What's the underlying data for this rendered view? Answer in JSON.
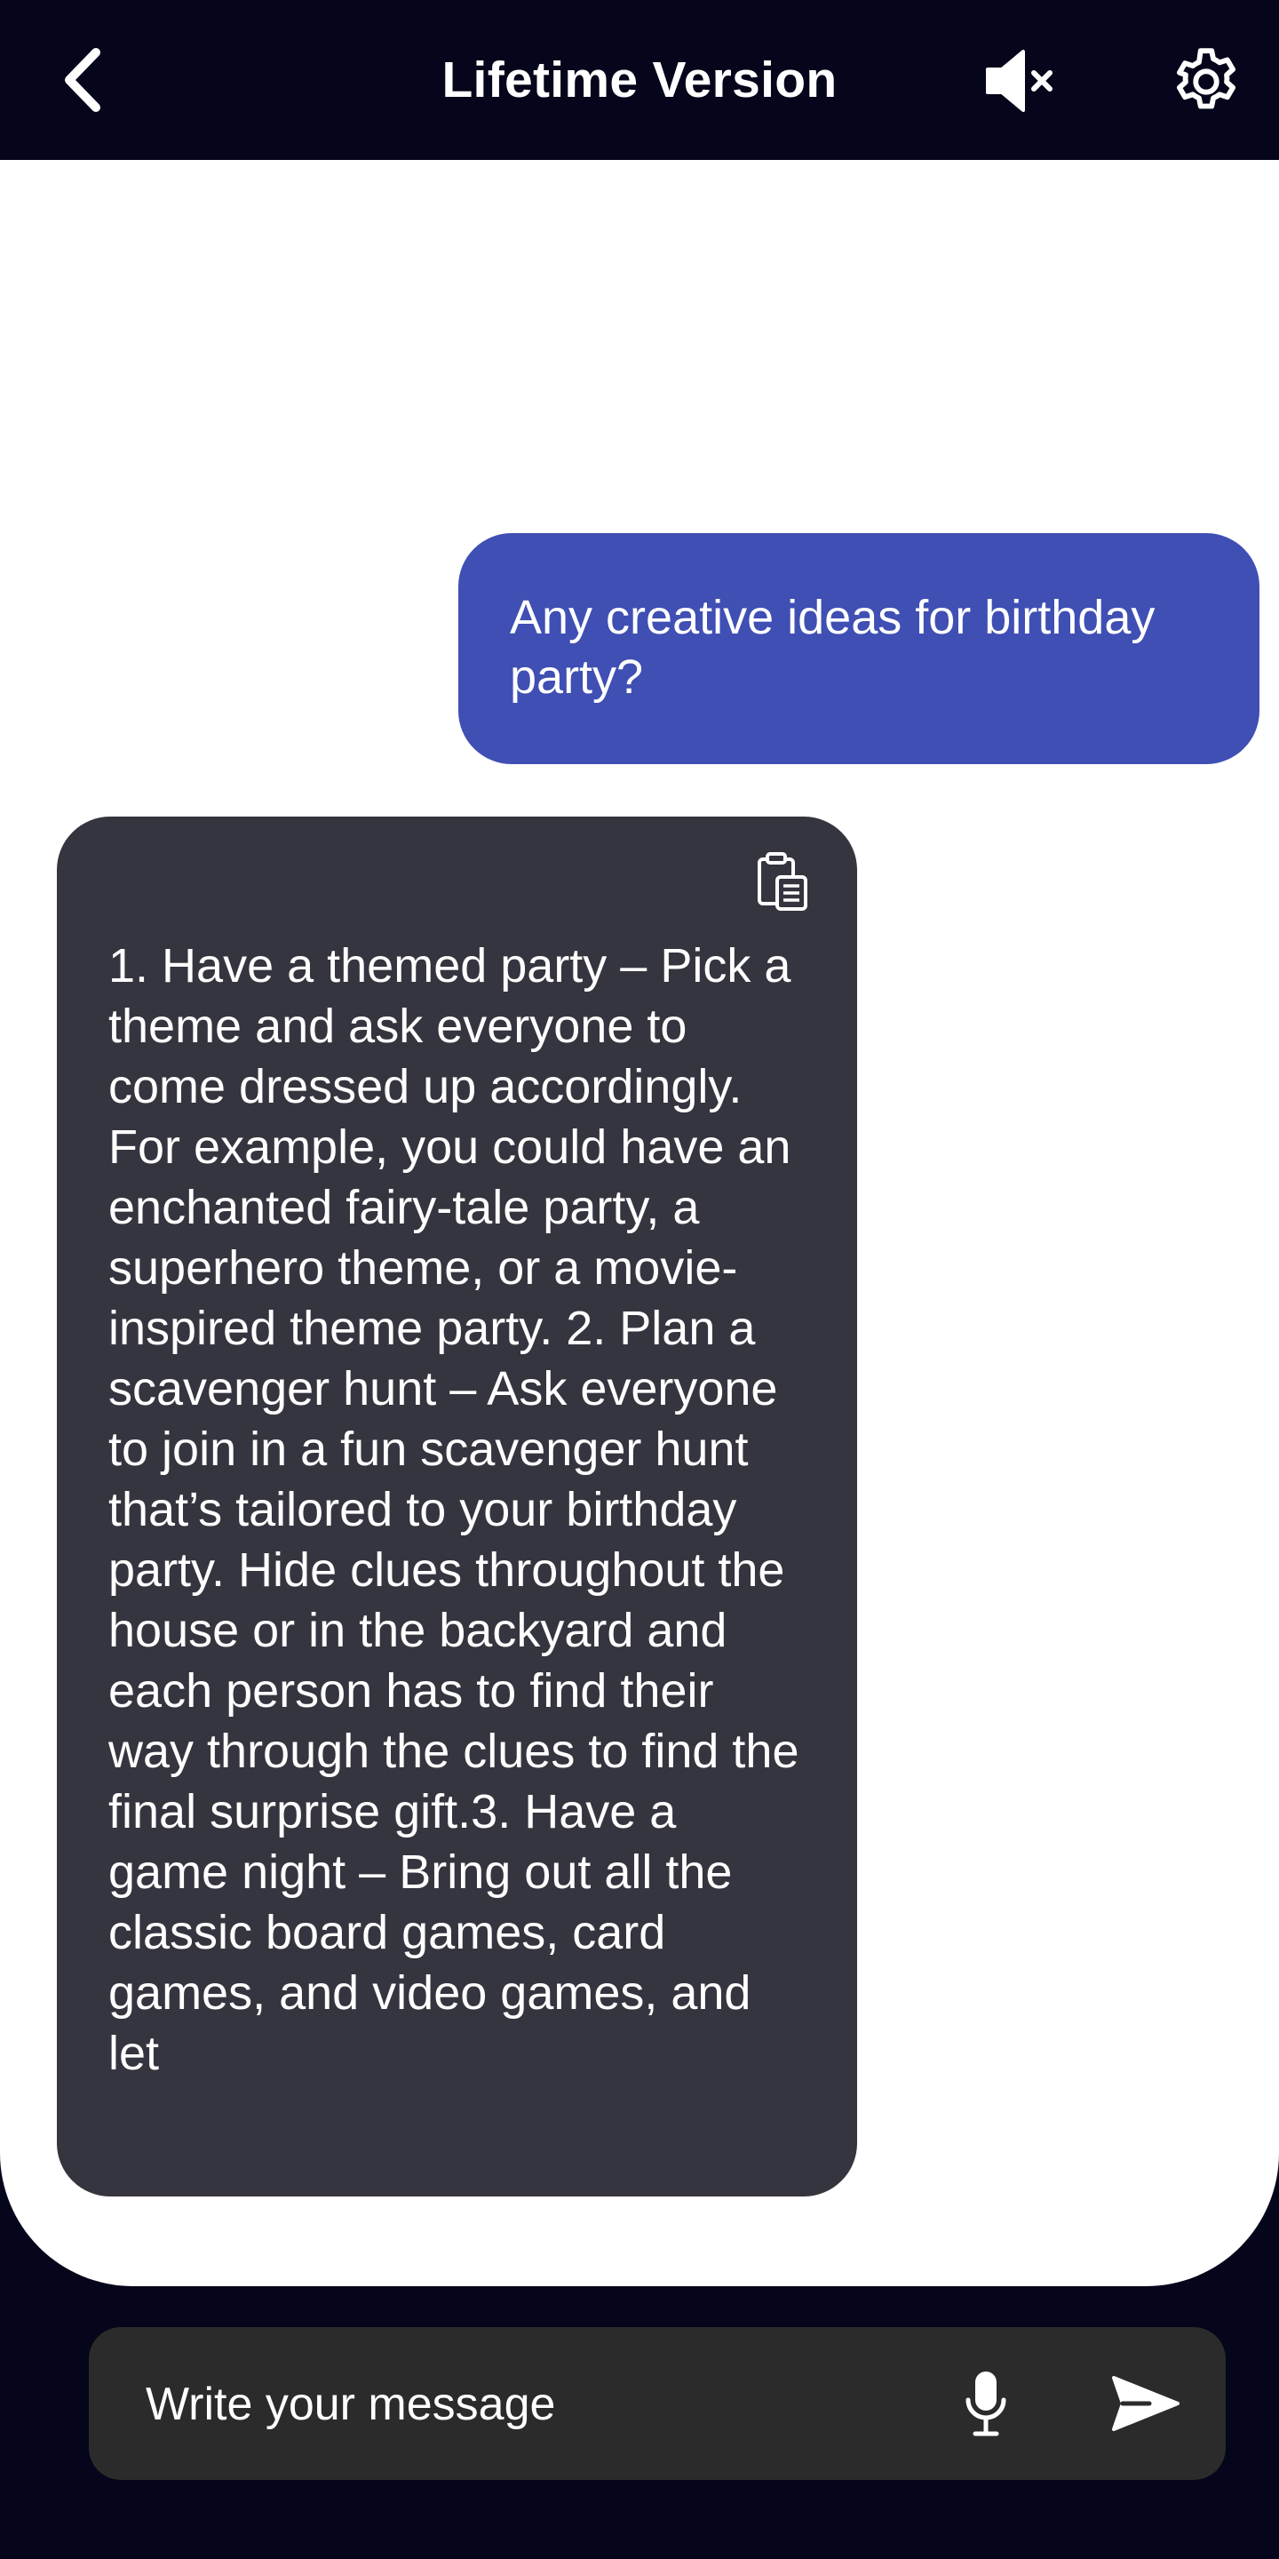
{
  "header": {
    "title": "Lifetime Version",
    "back_icon": "chevron-left-icon",
    "mute_icon": "speaker-muted-icon",
    "settings_icon": "gear-icon"
  },
  "chat": {
    "messages": [
      {
        "role": "user",
        "text": "Any creative ideas for birthday party?"
      },
      {
        "role": "assistant",
        "copy_icon": "clipboard-copy-icon",
        "text": "1. Have a themed party – Pick a theme and ask everyone to come dressed up accordingly. For example, you could have an enchanted fairy-tale party, a superhero theme, or a movie-inspired theme party. 2. Plan a scavenger hunt – Ask everyone to join in a fun scavenger hunt that’s tailored to your birthday party. Hide clues throughout the house or in the backyard and each person has to find their way through the clues to find the final surprise gift.3. Have a game night – Bring out all the classic board games, card games, and video games, and let"
      }
    ]
  },
  "composer": {
    "placeholder": "Write your message",
    "mic_icon": "microphone-icon",
    "send_icon": "send-icon"
  },
  "colors": {
    "background": "#05051b",
    "chat_background": "#ffffff",
    "user_bubble": "#3f4fb3",
    "assistant_bubble": "#35353f",
    "input_bar": "#2b2b2b"
  }
}
